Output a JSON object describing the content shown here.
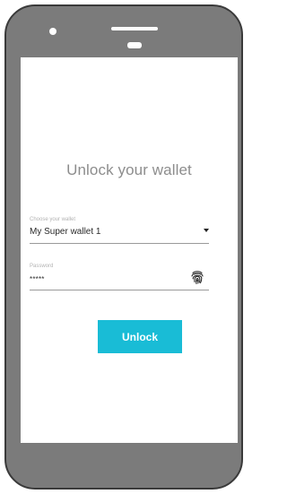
{
  "screen": {
    "title": "Unlock your wallet",
    "wallet_field": {
      "label": "Choose your wallet",
      "value": "My Super wallet 1",
      "icon": "chevron-down-icon"
    },
    "password_field": {
      "label": "Password",
      "value": "*****",
      "icon": "fingerprint-icon"
    },
    "unlock_label": "Unlock"
  },
  "colors": {
    "accent": "#19bcd6",
    "phone_body": "#7b7b7b",
    "title_text": "#8d8d8d"
  }
}
